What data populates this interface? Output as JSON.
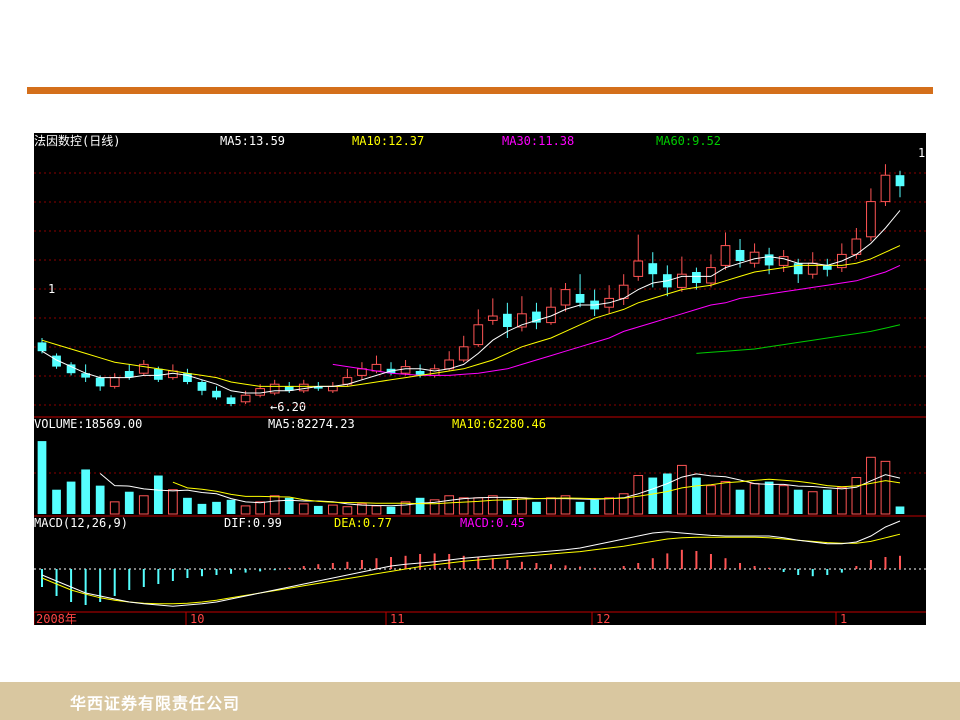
{
  "footer": {
    "company": "华西证券有限责任公司"
  },
  "colors": {
    "rule": "#d46f1b",
    "footer_bg": "#d9c7a0",
    "up": "#ff5555",
    "down": "#55ffff",
    "ma5": "#ffffff",
    "ma10": "#ffff00",
    "ma30": "#ff00ff",
    "ma60": "#00cc00",
    "grid": "#8b0000"
  },
  "chart_data": [
    {
      "type": "candlestick",
      "panel": "price",
      "header": {
        "name": "法因数控(日线)",
        "ma5": "MA5:13.59",
        "ma10": "MA10:12.37",
        "ma30": "MA30:11.38",
        "ma60": "MA60:9.52"
      },
      "annotations": {
        "low_label": "←6.20",
        "left_mark": "1",
        "right_mark": "1"
      },
      "ylim": [
        5.5,
        17.5
      ],
      "candles": [
        [
          8.8,
          8.4,
          9.0,
          8.3
        ],
        [
          8.2,
          7.7,
          8.3,
          7.6
        ],
        [
          7.8,
          7.4,
          7.9,
          7.3
        ],
        [
          7.4,
          7.2,
          7.8,
          7.0
        ],
        [
          7.2,
          6.8,
          7.3,
          6.6
        ],
        [
          6.8,
          7.2,
          7.4,
          6.7
        ],
        [
          7.5,
          7.2,
          7.8,
          7.1
        ],
        [
          7.4,
          7.8,
          8.0,
          7.3
        ],
        [
          7.6,
          7.1,
          7.7,
          7.0
        ],
        [
          7.2,
          7.5,
          7.8,
          7.1
        ],
        [
          7.4,
          7.0,
          7.6,
          6.9
        ],
        [
          7.0,
          6.6,
          7.1,
          6.4
        ],
        [
          6.6,
          6.3,
          6.8,
          6.2
        ],
        [
          6.3,
          6.0,
          6.4,
          5.9
        ],
        [
          6.1,
          6.4,
          6.6,
          6.0
        ],
        [
          6.4,
          6.7,
          6.9,
          6.3
        ],
        [
          6.5,
          6.9,
          7.1,
          6.4
        ],
        [
          6.8,
          6.6,
          7.0,
          6.5
        ],
        [
          6.6,
          6.9,
          7.1,
          6.5
        ],
        [
          6.8,
          6.7,
          7.0,
          6.6
        ],
        [
          6.6,
          6.8,
          7.0,
          6.5
        ],
        [
          6.9,
          7.2,
          7.6,
          6.8
        ],
        [
          7.3,
          7.6,
          7.9,
          7.1
        ],
        [
          7.5,
          7.8,
          8.2,
          7.4
        ],
        [
          7.6,
          7.4,
          7.9,
          7.3
        ],
        [
          7.4,
          7.7,
          8.0,
          7.3
        ],
        [
          7.5,
          7.3,
          7.8,
          7.2
        ],
        [
          7.3,
          7.6,
          7.8,
          7.2
        ],
        [
          7.6,
          8.0,
          8.4,
          7.5
        ],
        [
          8.0,
          8.6,
          9.1,
          7.9
        ],
        [
          8.7,
          9.6,
          10.3,
          8.6
        ],
        [
          9.8,
          10.0,
          10.8,
          9.6
        ],
        [
          10.1,
          9.5,
          10.6,
          9.0
        ],
        [
          9.5,
          10.1,
          10.9,
          9.3
        ],
        [
          10.2,
          9.7,
          10.6,
          9.4
        ],
        [
          9.7,
          10.4,
          11.3,
          9.6
        ],
        [
          10.5,
          11.2,
          11.5,
          10.2
        ],
        [
          11.0,
          10.6,
          11.9,
          10.4
        ],
        [
          10.7,
          10.3,
          11.2,
          10.0
        ],
        [
          10.4,
          10.8,
          11.4,
          10.1
        ],
        [
          10.8,
          11.4,
          11.9,
          10.5
        ],
        [
          11.8,
          12.5,
          13.7,
          11.6
        ],
        [
          12.4,
          11.9,
          12.9,
          11.3
        ],
        [
          11.9,
          11.3,
          12.3,
          10.9
        ],
        [
          11.3,
          11.9,
          12.7,
          11.1
        ],
        [
          12.0,
          11.5,
          12.2,
          11.2
        ],
        [
          11.5,
          12.2,
          12.8,
          11.3
        ],
        [
          12.3,
          13.2,
          13.8,
          12.1
        ],
        [
          13.0,
          12.5,
          13.5,
          12.2
        ],
        [
          12.4,
          12.9,
          13.3,
          12.2
        ],
        [
          12.8,
          12.3,
          13.1,
          11.9
        ],
        [
          12.3,
          12.7,
          13.0,
          12.0
        ],
        [
          12.4,
          11.9,
          12.6,
          11.5
        ],
        [
          11.9,
          12.4,
          12.9,
          11.7
        ],
        [
          12.3,
          12.1,
          12.6,
          11.8
        ],
        [
          12.2,
          12.8,
          13.3,
          12.0
        ],
        [
          12.8,
          13.5,
          14.0,
          12.6
        ],
        [
          13.6,
          15.2,
          15.8,
          13.4
        ],
        [
          15.2,
          16.4,
          16.9,
          15.0
        ],
        [
          16.4,
          15.9,
          16.6,
          15.4
        ]
      ],
      "ma5": [
        8.4,
        8.0,
        7.7,
        7.4,
        7.2,
        7.2,
        7.2,
        7.3,
        7.3,
        7.4,
        7.3,
        7.1,
        6.9,
        6.6,
        6.5,
        6.5,
        6.6,
        6.6,
        6.7,
        6.8,
        6.8,
        6.9,
        7.1,
        7.3,
        7.5,
        7.6,
        7.6,
        7.5,
        7.6,
        7.8,
        8.3,
        8.9,
        9.3,
        9.6,
        9.8,
        10.0,
        10.3,
        10.5,
        10.5,
        10.6,
        10.8,
        11.2,
        11.5,
        11.6,
        11.8,
        11.8,
        11.8,
        12.2,
        12.4,
        12.6,
        12.7,
        12.6,
        12.4,
        12.4,
        12.3,
        12.5,
        12.8,
        13.3,
        14.0,
        14.8
      ],
      "ma10": [
        8.9,
        8.7,
        8.5,
        8.3,
        8.1,
        7.9,
        7.8,
        7.7,
        7.6,
        7.5,
        7.4,
        7.3,
        7.2,
        7.0,
        6.9,
        6.8,
        6.8,
        6.8,
        6.8,
        6.8,
        6.8,
        6.8,
        6.9,
        7.0,
        7.1,
        7.2,
        7.3,
        7.4,
        7.5,
        7.6,
        7.8,
        8.0,
        8.3,
        8.6,
        8.8,
        9.0,
        9.3,
        9.6,
        9.9,
        10.1,
        10.3,
        10.6,
        10.8,
        11.0,
        11.2,
        11.3,
        11.4,
        11.6,
        11.8,
        12.0,
        12.1,
        12.2,
        12.3,
        12.3,
        12.3,
        12.3,
        12.4,
        12.6,
        12.9,
        13.2
      ],
      "ma30": [
        null,
        null,
        null,
        null,
        null,
        null,
        null,
        null,
        null,
        null,
        null,
        null,
        null,
        null,
        null,
        null,
        null,
        null,
        null,
        null,
        7.8,
        7.7,
        7.6,
        7.5,
        7.4,
        7.35,
        7.3,
        7.3,
        7.3,
        7.35,
        7.4,
        7.5,
        7.6,
        7.8,
        8.0,
        8.2,
        8.4,
        8.6,
        8.8,
        9.0,
        9.3,
        9.5,
        9.7,
        9.9,
        10.1,
        10.3,
        10.5,
        10.6,
        10.8,
        10.9,
        11.0,
        11.1,
        11.2,
        11.3,
        11.4,
        11.5,
        11.6,
        11.8,
        12.0,
        12.3
      ],
      "ma60": [
        null,
        null,
        null,
        null,
        null,
        null,
        null,
        null,
        null,
        null,
        null,
        null,
        null,
        null,
        null,
        null,
        null,
        null,
        null,
        null,
        null,
        null,
        null,
        null,
        null,
        null,
        null,
        null,
        null,
        null,
        null,
        null,
        null,
        null,
        null,
        null,
        null,
        null,
        null,
        null,
        null,
        null,
        null,
        null,
        null,
        8.3,
        8.35,
        8.4,
        8.45,
        8.5,
        8.6,
        8.7,
        8.8,
        8.9,
        9.0,
        9.1,
        9.2,
        9.3,
        9.45,
        9.6
      ]
    },
    {
      "type": "bar",
      "panel": "volume",
      "header": {
        "title": "VOLUME:18569.00",
        "ma5": "MA5:82274.23",
        "ma10": "MA10:62280.46"
      },
      "ylim": [
        0,
        200000
      ],
      "values": [
        180000,
        60000,
        80000,
        110000,
        70000,
        30000,
        55000,
        45000,
        95000,
        60000,
        40000,
        25000,
        30000,
        35000,
        20000,
        30000,
        45000,
        40000,
        25000,
        20000,
        22000,
        18000,
        25000,
        20000,
        18000,
        30000,
        40000,
        35000,
        45000,
        40000,
        40000,
        45000,
        35000,
        40000,
        30000,
        40000,
        45000,
        30000,
        35000,
        40000,
        50000,
        95000,
        90000,
        100000,
        120000,
        90000,
        70000,
        80000,
        60000,
        75000,
        80000,
        70000,
        60000,
        55000,
        60000,
        65000,
        90000,
        140000,
        130000,
        18569
      ]
    },
    {
      "type": "bar",
      "panel": "macd",
      "header": {
        "title": "MACD(12,26,9)",
        "dif": "DIF:0.99",
        "dea": "DEA:0.77",
        "macd": "MACD:0.45"
      },
      "ylim": [
        -0.7,
        0.6
      ],
      "values": [
        -0.3,
        -0.45,
        -0.55,
        -0.6,
        -0.55,
        -0.45,
        -0.35,
        -0.3,
        -0.25,
        -0.2,
        -0.15,
        -0.12,
        -0.1,
        -0.08,
        -0.06,
        -0.04,
        -0.02,
        0.02,
        0.05,
        0.08,
        0.1,
        0.12,
        0.15,
        0.18,
        0.2,
        0.22,
        0.25,
        0.26,
        0.25,
        0.22,
        0.2,
        0.18,
        0.15,
        0.12,
        0.1,
        0.08,
        0.06,
        0.04,
        0.02,
        0.0,
        0.05,
        0.1,
        0.18,
        0.26,
        0.32,
        0.3,
        0.25,
        0.18,
        0.1,
        0.05,
        0.02,
        -0.05,
        -0.1,
        -0.12,
        -0.1,
        -0.06,
        0.05,
        0.15,
        0.2,
        0.22
      ],
      "dif": [
        -0.1,
        -0.2,
        -0.3,
        -0.4,
        -0.45,
        -0.5,
        -0.55,
        -0.58,
        -0.6,
        -0.62,
        -0.6,
        -0.58,
        -0.55,
        -0.5,
        -0.45,
        -0.4,
        -0.35,
        -0.3,
        -0.25,
        -0.2,
        -0.15,
        -0.1,
        -0.05,
        0.0,
        0.05,
        0.08,
        0.1,
        0.12,
        0.15,
        0.18,
        0.2,
        0.22,
        0.24,
        0.26,
        0.28,
        0.3,
        0.32,
        0.35,
        0.4,
        0.45,
        0.5,
        0.55,
        0.6,
        0.62,
        0.6,
        0.58,
        0.56,
        0.55,
        0.55,
        0.55,
        0.55,
        0.52,
        0.48,
        0.45,
        0.42,
        0.42,
        0.45,
        0.55,
        0.7,
        0.8
      ],
      "dea": [
        -0.15,
        -0.25,
        -0.35,
        -0.42,
        -0.48,
        -0.52,
        -0.55,
        -0.57,
        -0.58,
        -0.58,
        -0.57,
        -0.55,
        -0.52,
        -0.48,
        -0.44,
        -0.4,
        -0.36,
        -0.32,
        -0.28,
        -0.24,
        -0.2,
        -0.16,
        -0.12,
        -0.08,
        -0.04,
        0.0,
        0.04,
        0.07,
        0.1,
        0.13,
        0.15,
        0.17,
        0.19,
        0.21,
        0.23,
        0.25,
        0.27,
        0.29,
        0.32,
        0.35,
        0.38,
        0.42,
        0.46,
        0.5,
        0.52,
        0.53,
        0.53,
        0.53,
        0.53,
        0.53,
        0.52,
        0.5,
        0.48,
        0.46,
        0.44,
        0.43,
        0.43,
        0.46,
        0.52,
        0.58
      ]
    }
  ],
  "time_axis": {
    "labels": [
      "2008年",
      "10",
      "11",
      "12",
      "1"
    ]
  }
}
